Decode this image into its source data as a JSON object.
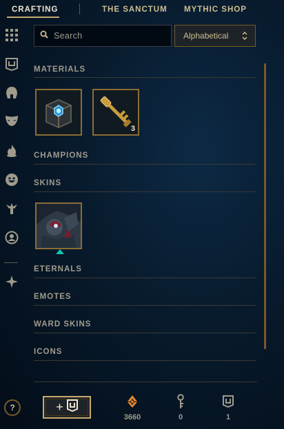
{
  "nav": {
    "tabs": [
      {
        "label": "CRAFTING",
        "active": true
      },
      {
        "label": "THE SANCTUM",
        "active": false
      },
      {
        "label": "MYTHIC SHOP",
        "active": false
      }
    ]
  },
  "sidebar": {
    "icons": [
      "all-grid-icon",
      "chest-icon",
      "champion-helmet-icon",
      "skin-mask-icon",
      "ward-flame-icon",
      "emote-face-icon",
      "eternals-icon",
      "profile-icon-icon",
      "other-icon"
    ]
  },
  "search": {
    "placeholder": "Search",
    "value": ""
  },
  "sort": {
    "selected": "Alphabetical"
  },
  "sections": {
    "materials": {
      "title": "MATERIALS",
      "items": [
        {
          "name": "hextech-chest",
          "count": ""
        },
        {
          "name": "hextech-key",
          "count": "3"
        }
      ]
    },
    "champions": {
      "title": "CHAMPIONS"
    },
    "skins": {
      "title": "SKINS",
      "items": [
        {
          "name": "skin-shard",
          "count": ""
        }
      ]
    },
    "eternals": {
      "title": "ETERNALS"
    },
    "emotes": {
      "title": "EMOTES"
    },
    "ward_skins": {
      "title": "WARD SKINS"
    },
    "icons": {
      "title": "ICONS"
    }
  },
  "footer": {
    "help_label": "?",
    "craft_plus": "+",
    "currencies": [
      {
        "icon": "orange-essence-icon",
        "value": "3660",
        "color": "#e8862e"
      },
      {
        "icon": "key-fragment-icon",
        "value": "0",
        "color": "#a09b8c"
      },
      {
        "icon": "chest-icon",
        "value": "1",
        "color": "#a09b8c"
      }
    ]
  },
  "colors": {
    "gold": "#c8aa6e",
    "text": "#a09b8c",
    "accent": "#0ac8b9",
    "essence": "#e8862e"
  }
}
